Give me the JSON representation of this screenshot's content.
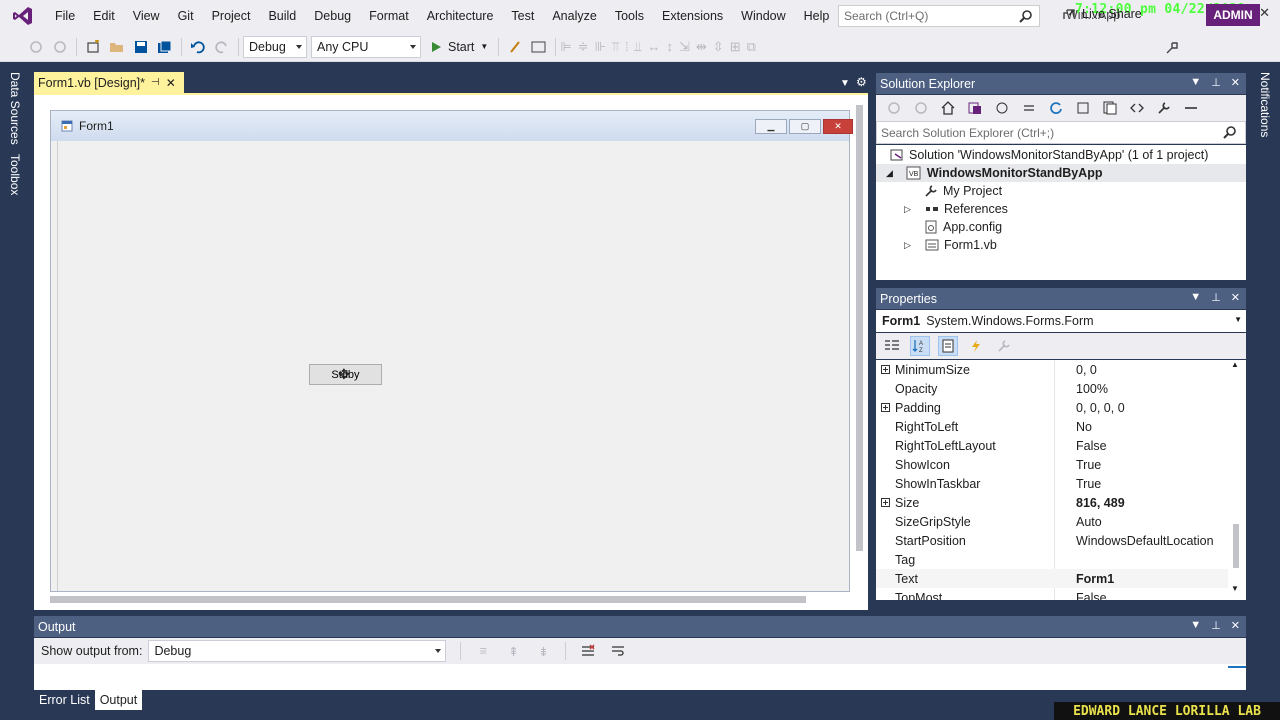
{
  "menu": {
    "items": [
      "File",
      "Edit",
      "View",
      "Git",
      "Project",
      "Build",
      "Debug",
      "Format",
      "Architecture",
      "Test",
      "Analyze",
      "Tools",
      "Extensions",
      "Window",
      "Help"
    ],
    "search_placeholder": "Search (Ctrl+Q)",
    "app_name": "Win...App",
    "clock": "7:12:00 pm 04/22/2021"
  },
  "toolbar": {
    "config": "Debug",
    "platform": "Any CPU",
    "start": "Start",
    "live_share": "Live Share",
    "admin": "ADMIN"
  },
  "side_tabs": [
    "Data Sources",
    "Toolbox"
  ],
  "right_tabs": [
    "Notifications"
  ],
  "designer": {
    "tab_title": "Form1.vb [Design]*",
    "form_title": "Form1",
    "button_text": "Stdby"
  },
  "solution_explorer": {
    "title": "Solution Explorer",
    "search_placeholder": "Search Solution Explorer (Ctrl+;)",
    "solution": "Solution 'WindowsMonitorStandByApp' (1 of 1 project)",
    "project": "WindowsMonitorStandByApp",
    "items": [
      "My Project",
      "References",
      "App.config",
      "Form1.vb"
    ]
  },
  "properties": {
    "title": "Properties",
    "target_name": "Form1",
    "target_type": "System.Windows.Forms.Form",
    "rows": [
      {
        "name": "MinimumSize",
        "value": "0, 0",
        "expandable": true,
        "bold": false
      },
      {
        "name": "Opacity",
        "value": "100%",
        "expandable": false,
        "bold": false
      },
      {
        "name": "Padding",
        "value": "0, 0, 0, 0",
        "expandable": true,
        "bold": false
      },
      {
        "name": "RightToLeft",
        "value": "No",
        "expandable": false,
        "bold": false
      },
      {
        "name": "RightToLeftLayout",
        "value": "False",
        "expandable": false,
        "bold": false
      },
      {
        "name": "ShowIcon",
        "value": "True",
        "expandable": false,
        "bold": false
      },
      {
        "name": "ShowInTaskbar",
        "value": "True",
        "expandable": false,
        "bold": false
      },
      {
        "name": "Size",
        "value": "816, 489",
        "expandable": true,
        "bold": true
      },
      {
        "name": "SizeGripStyle",
        "value": "Auto",
        "expandable": false,
        "bold": false
      },
      {
        "name": "StartPosition",
        "value": "WindowsDefaultLocation",
        "expandable": false,
        "bold": false
      },
      {
        "name": "Tag",
        "value": "",
        "expandable": false,
        "bold": false
      },
      {
        "name": "Text",
        "value": "Form1",
        "expandable": false,
        "bold": true
      },
      {
        "name": "TopMost",
        "value": "False",
        "expandable": false,
        "bold": false
      }
    ]
  },
  "output": {
    "title": "Output",
    "show_from_label": "Show output from:",
    "source": "Debug",
    "tabs": [
      "Error List",
      "Output"
    ]
  },
  "watermark": "EDWARD LANCE LORILLA LAB",
  "colors": {
    "accent": "#68217a",
    "panel_header": "#4d6082",
    "background": "#293955",
    "doc_tab": "#fff29d"
  }
}
